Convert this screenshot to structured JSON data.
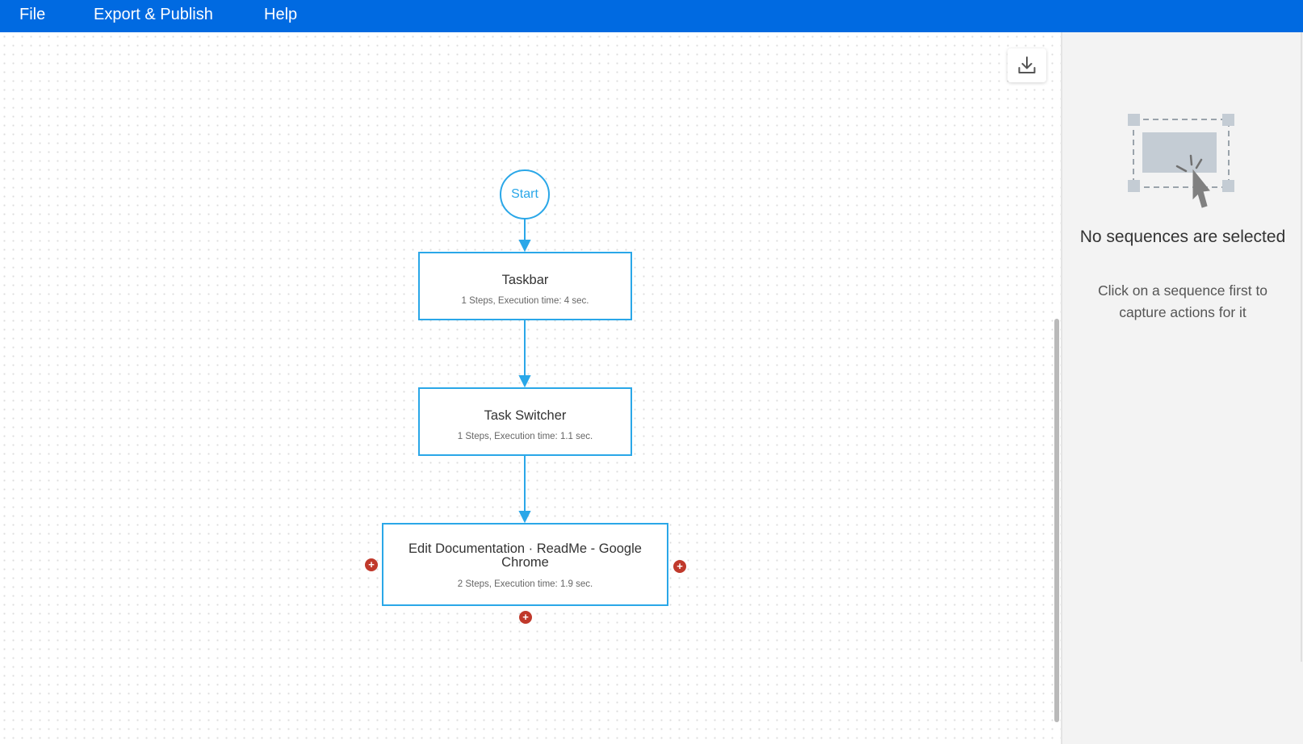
{
  "menu": {
    "file": "File",
    "export_publish": "Export & Publish",
    "help": "Help"
  },
  "canvas": {
    "download_icon": "download-icon",
    "start_label": "Start",
    "sequences": [
      {
        "title": "Taskbar",
        "meta": "1 Steps, Execution time: 4 sec."
      },
      {
        "title": "Task Switcher",
        "meta": "1 Steps, Execution time: 1.1 sec."
      },
      {
        "title": "Edit Documentation · ReadMe - Google Chrome",
        "meta": "2 Steps, Execution time: 1.9 sec."
      }
    ],
    "add_icon": "+"
  },
  "side_panel": {
    "illustration_icon": "selection-cursor-icon",
    "title": "No sequences are selected",
    "description": "Click on a sequence first to capture actions for it"
  },
  "colors": {
    "menubar": "#006ae1",
    "node_border": "#2aa7e8",
    "add_dot": "#c0392b",
    "panel_bg": "#f3f3f3"
  }
}
